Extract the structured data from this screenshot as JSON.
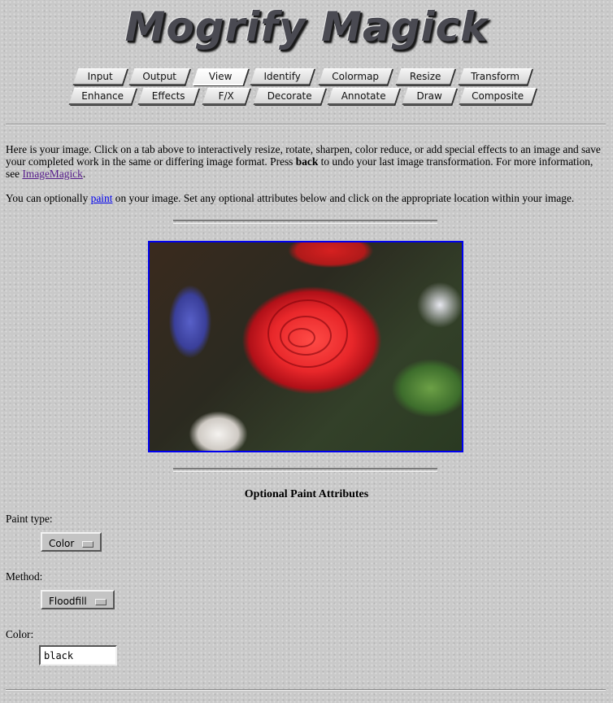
{
  "header": {
    "logo_text": "Mogrify Magick"
  },
  "tabs_row1": [
    {
      "label": "Input"
    },
    {
      "label": "Output"
    },
    {
      "label": "View",
      "active": true
    },
    {
      "label": "Identify"
    },
    {
      "label": "Colormap"
    },
    {
      "label": "Resize"
    },
    {
      "label": "Transform"
    }
  ],
  "tabs_row2": [
    {
      "label": "Enhance"
    },
    {
      "label": "Effects"
    },
    {
      "label": "F/X"
    },
    {
      "label": "Decorate"
    },
    {
      "label": "Annotate"
    },
    {
      "label": "Draw"
    },
    {
      "label": "Composite"
    }
  ],
  "intro": {
    "part1": "Here is your image. Click on a tab above to interactively resize, rotate, sharpen, color reduce, or add special effects to an image and save your completed work in the same or differing image format. Press ",
    "bold": "back",
    "part2": " to undo your last image transformation. For more information, see ",
    "link": "ImageMagick",
    "part3": "."
  },
  "paint_note": {
    "part1": "You can optionally ",
    "link": "paint",
    "part2": " on your image. Set any optional attributes below and click on the appropriate location within your image."
  },
  "image": {
    "subject": "red rose photograph"
  },
  "attributes": {
    "title": "Optional Paint Attributes",
    "paint_type_label": "Paint type:",
    "paint_type_value": "Color",
    "method_label": "Method:",
    "method_value": "Floodfill",
    "color_label": "Color:",
    "color_value": "black"
  },
  "colors": {
    "link": "#0000ee",
    "visited_link": "#551a8b",
    "image_border": "#0000ee"
  }
}
